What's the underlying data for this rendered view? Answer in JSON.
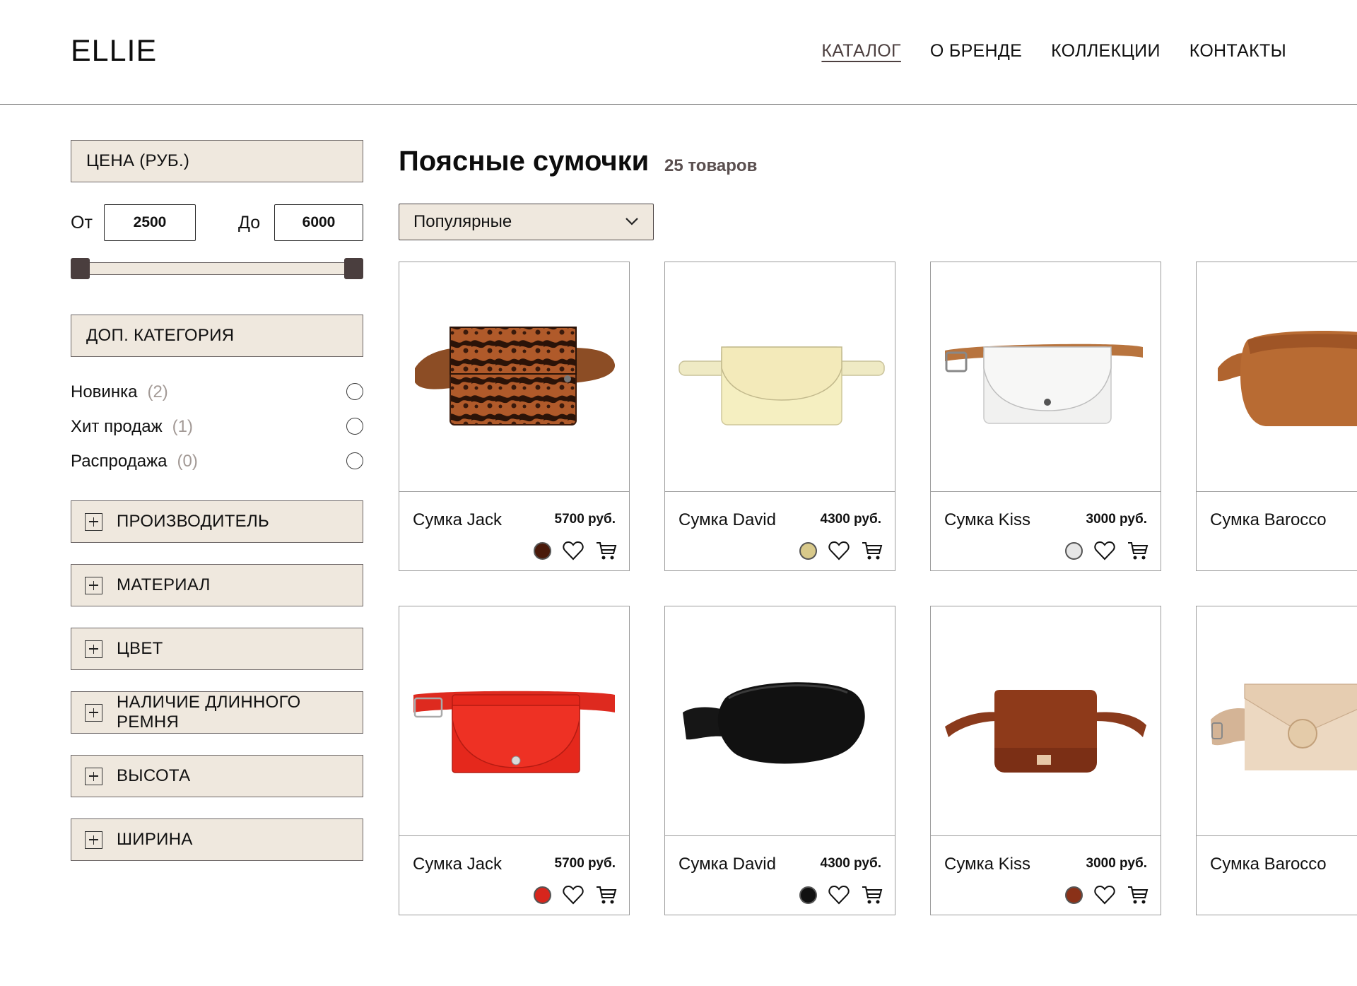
{
  "header": {
    "logo": "ELLIE",
    "nav": [
      "КАТАЛОГ",
      "О БРЕНДЕ",
      "КОЛЛЕКЦИИ",
      "КОНТАКТЫ"
    ]
  },
  "filters": {
    "price": {
      "title": "ЦЕНА (РУБ.)",
      "from_label": "От",
      "to_label": "До",
      "from_value": "2500",
      "to_value": "6000"
    },
    "category": {
      "title": "ДОП. КАТЕГОРИЯ",
      "items": [
        {
          "label": "Новинка",
          "count": "(2)"
        },
        {
          "label": "Хит продаж",
          "count": "(1)"
        },
        {
          "label": "Распродажа",
          "count": "(0)"
        }
      ]
    },
    "accordions": [
      "ПРОИЗВОДИТЕЛЬ",
      "МАТЕРИАЛ",
      "ЦВЕТ",
      "НАЛИЧИЕ ДЛИННОГО РЕМНЯ",
      "ВЫСОТА",
      "ШИРИНА"
    ]
  },
  "main": {
    "title": "Поясные сумочки",
    "count": "25 товаров",
    "sort": "Популярные"
  },
  "products": [
    {
      "name": "Сумка Jack",
      "price": "5700 руб.",
      "color": "#4a1a0a"
    },
    {
      "name": "Сумка David",
      "price": "4300 руб.",
      "color": "#d8c98a"
    },
    {
      "name": "Сумка Kiss",
      "price": "3000 руб.",
      "color": "#e6e6e6"
    },
    {
      "name": "Сумка Barocco",
      "price": "",
      "color": ""
    },
    {
      "name": "Сумка Jack",
      "price": "5700 руб.",
      "color": "#d7261d"
    },
    {
      "name": "Сумка David",
      "price": "4300 руб.",
      "color": "#111111"
    },
    {
      "name": "Сумка Kiss",
      "price": "3000 руб.",
      "color": "#8a3118"
    },
    {
      "name": "Сумка Barocco",
      "price": "",
      "color": ""
    }
  ],
  "colors": {
    "panel": "#efe8de",
    "handle": "#4a3e3e",
    "nav_active": "#4d4040"
  }
}
